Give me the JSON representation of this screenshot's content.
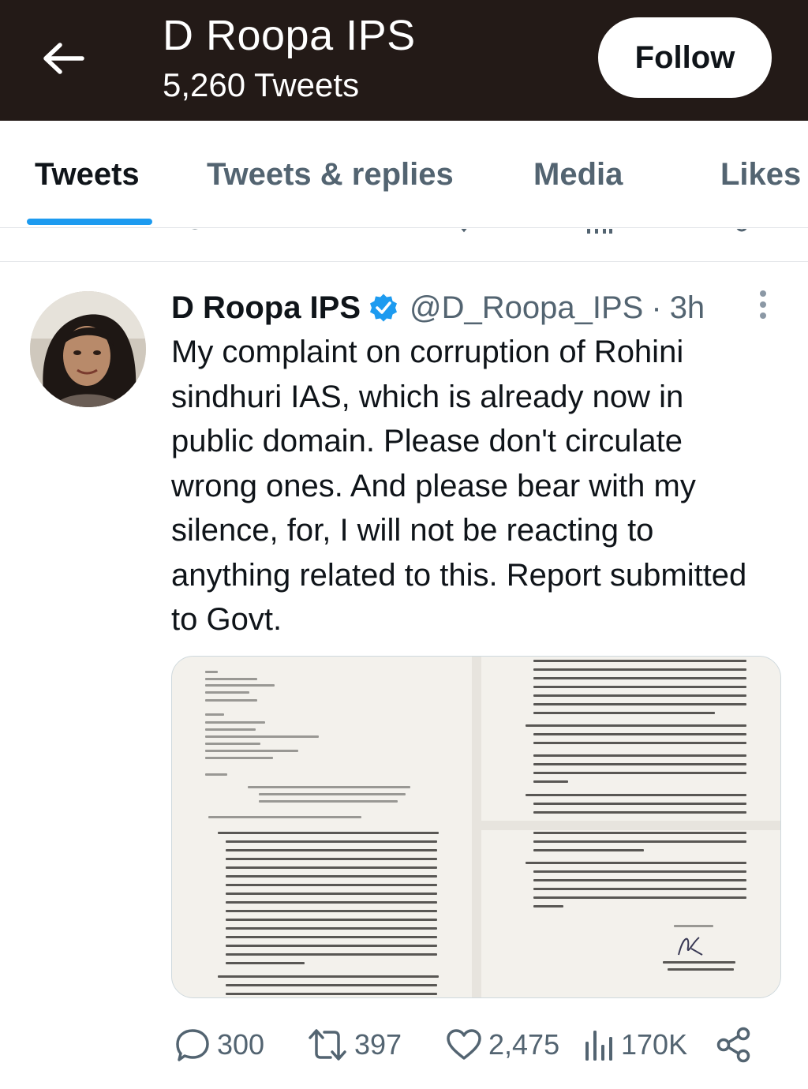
{
  "header": {
    "back_icon": "arrow-left-icon",
    "name": "D Roopa IPS",
    "tweet_count": "5,260 Tweets",
    "follow_label": "Follow"
  },
  "tabs": [
    {
      "label": "Tweets",
      "active": true
    },
    {
      "label": "Tweets & replies",
      "active": false
    },
    {
      "label": "Media",
      "active": false
    },
    {
      "label": "Likes",
      "active": false
    }
  ],
  "tweet": {
    "author_name": "D Roopa IPS",
    "verified": true,
    "handle": "@D_Roopa_IPS",
    "separator": "·",
    "time": "3h",
    "text": "My complaint on corruption of Rohini sindhuri IAS, which is already now in public domain. Please don't circulate wrong ones. And please bear with my silence, for, I will not be reacting to anything related to this. Report submitted to Govt.",
    "media": {
      "document_left": {
        "to_block": [
          "To,",
          "The Chief Secretary,",
          "Government of Karnataka,",
          "Vidhana Soudha,",
          "Bangalore 560 001."
        ],
        "from_block": [
          "From",
          "D Roopa Moudgil, IPS,",
          "Managing Director",
          "Karnataka State Handicrafts Development",
          "Corporation Limited,",
          "No.39, 2nd Floor, United Mansions,",
          "M.G.Road, Bangalore 560 001."
        ],
        "salutation": "Madam,",
        "subject": "Sub: Request to speedily the inquiry into already existing complaints against Rohini Sindhuri, IAS and to take up fresh inquiries on certain other matters related to corruption as listed below-",
        "intro": "With reference to above subject, I wish to submit that-"
      },
      "document_right": {
        "closing": "Yours faithfully,",
        "signatory": "(D ROOPA MOUDGIL, IPS)",
        "designation": "MANAGING DIRECTOR"
      }
    },
    "actions": {
      "replies": "300",
      "retweets": "397",
      "likes": "2,475",
      "views": "170K"
    }
  },
  "colors": {
    "header_bg": "#231a17",
    "accent": "#1d9bf0",
    "muted_text": "#536471",
    "primary_text": "#0f1419"
  }
}
